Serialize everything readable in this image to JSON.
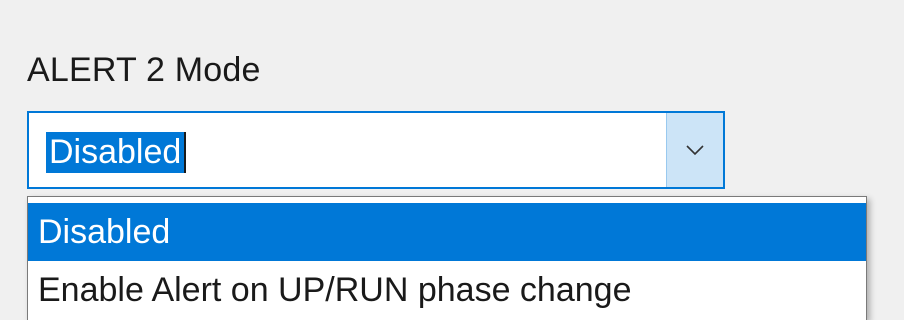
{
  "field": {
    "label": "ALERT 2 Mode"
  },
  "combo": {
    "value": "Disabled"
  },
  "dropdown": {
    "options": [
      {
        "label": "Disabled",
        "selected": true
      },
      {
        "label": "Enable Alert on UP/RUN phase change",
        "selected": false
      }
    ]
  },
  "colors": {
    "accent": "#0078d7",
    "button_bg": "#cce4f7",
    "background": "#f0f0f0"
  },
  "icons": {
    "dropdown": "chevron-down-icon"
  }
}
